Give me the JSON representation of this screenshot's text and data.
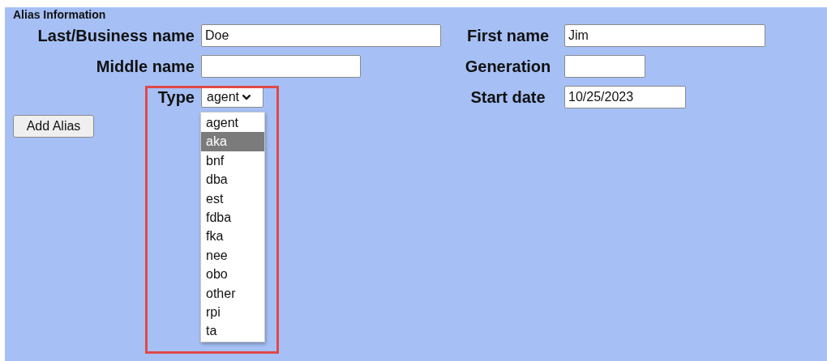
{
  "section_title": "Alias Information",
  "rows": [
    {
      "left": {
        "kind": "text",
        "label": "Last/Business name",
        "value": "Doe"
      },
      "right": {
        "kind": "text",
        "label": "First name",
        "value": "Jim"
      }
    },
    {
      "left": {
        "kind": "text",
        "label": "Middle name"
      },
      "right": {
        "kind": "text",
        "label": "Generation"
      }
    },
    {
      "left": {
        "kind": "select",
        "label": "Type",
        "value": "agent",
        "expanded": true,
        "options": [
          {
            "label": "agent",
            "highlighted": false
          },
          {
            "label": "aka",
            "highlighted": true
          },
          {
            "label": "bnf",
            "highlighted": false
          },
          {
            "label": "dba",
            "highlighted": false
          },
          {
            "label": "est",
            "highlighted": false
          },
          {
            "label": "fdba",
            "highlighted": false
          },
          {
            "label": "fka",
            "highlighted": false
          },
          {
            "label": "nee",
            "highlighted": false
          },
          {
            "label": "obo",
            "highlighted": false
          },
          {
            "label": "other",
            "highlighted": false
          },
          {
            "label": "rpi",
            "highlighted": false
          },
          {
            "label": "ta",
            "highlighted": false
          }
        ]
      },
      "right": {
        "kind": "text",
        "label": "Start date",
        "value": "10/25/2023"
      }
    }
  ],
  "add_button": "Add Alias"
}
